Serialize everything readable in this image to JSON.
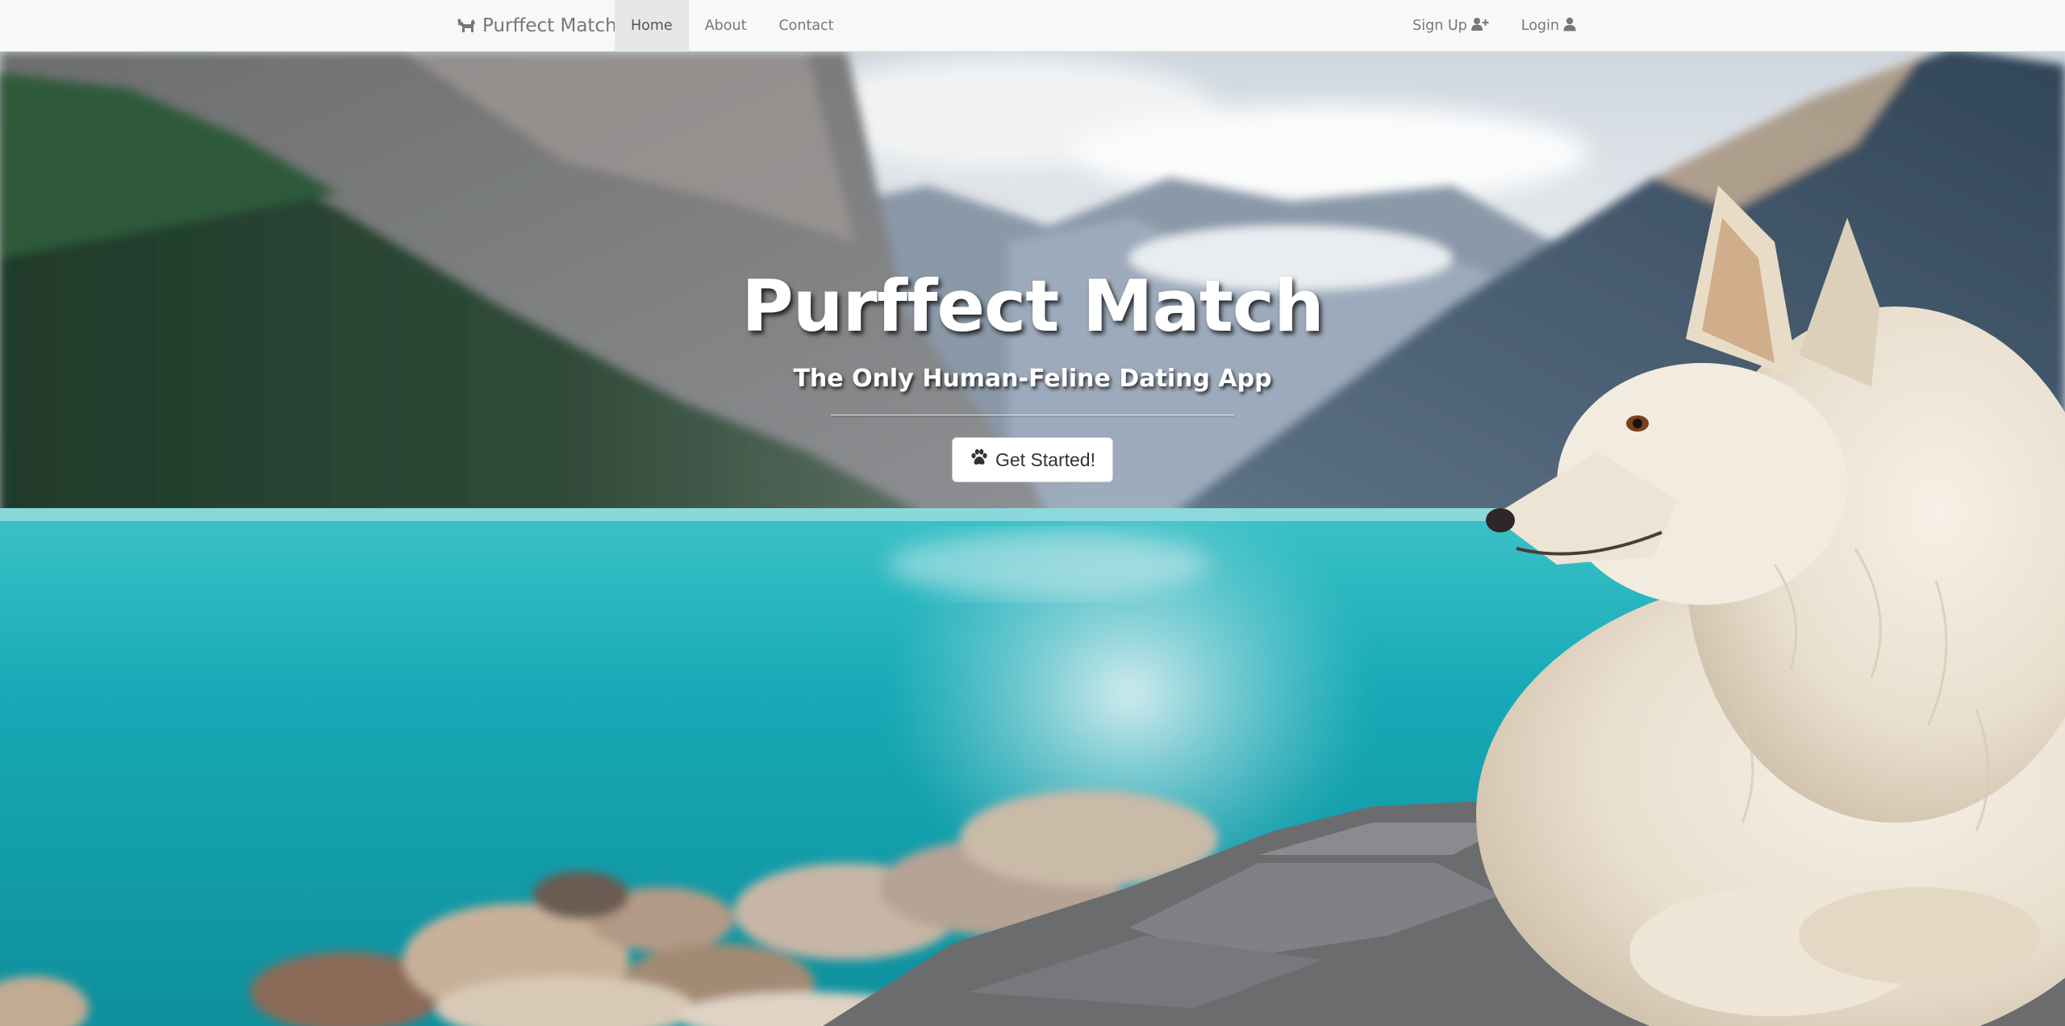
{
  "navbar": {
    "brand": {
      "icon": "dog-icon",
      "label": "Purffect Match"
    },
    "left_items": [
      {
        "label": "Home",
        "active": true
      },
      {
        "label": "About",
        "active": false
      },
      {
        "label": "Contact",
        "active": false
      }
    ],
    "right_items": [
      {
        "label": "Sign Up",
        "icon": "user-plus-icon"
      },
      {
        "label": "Login",
        "icon": "user-icon"
      }
    ]
  },
  "hero": {
    "title": "Purffect Match",
    "subtitle": "The Only Human-Feline Dating App",
    "cta": {
      "label": "Get Started!",
      "icon": "paw-icon"
    },
    "background": "photo of a white fluffy dog beside a turquoise mountain lake"
  },
  "colors": {
    "navbar_bg": "#f8f8f8",
    "nav_text": "#777777",
    "nav_active_bg": "#e7e7e7",
    "hero_text": "#ffffff",
    "lake": "#1aaeb9",
    "button_bg": "#ffffff"
  }
}
